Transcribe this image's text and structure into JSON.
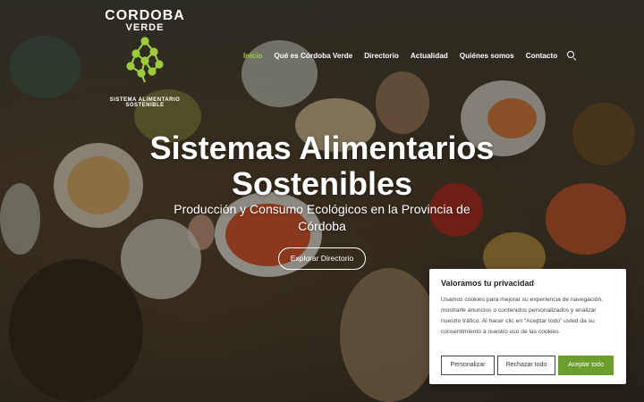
{
  "logo": {
    "title": "CORDOBA",
    "subtitle": "VERDE",
    "arc_text": "SISTEMA ALIMENTARIO SOSTENIBLE"
  },
  "nav": {
    "items": [
      {
        "label": "Inicio",
        "active": true
      },
      {
        "label": "Qué es Córdoba Verde"
      },
      {
        "label": "Directorio"
      },
      {
        "label": "Actualidad"
      },
      {
        "label": "Quiénes somos"
      },
      {
        "label": "Contacto"
      }
    ],
    "search_icon": "search-icon"
  },
  "hero": {
    "title": "Sistemas Alimentarios Sostenibles",
    "subtitle": "Producción y Consumo Ecológicos en la Provincia de Córdoba",
    "cta": "Explorar Directorio"
  },
  "cookie": {
    "title": "Valoramos tu privacidad",
    "text": "Usamos cookies para mejorar su experiencia de navegación, mostrarle anuncios o contenidos personalizados y analizar nuestro tráfico. Al hacer clic en “Aceptar todo” usted da su consentimiento a nuestro uso de las cookies.",
    "customize": "Personalizar",
    "reject": "Rechazar todo",
    "accept": "Aceptar todo"
  },
  "colors": {
    "accent": "#9ccc3c",
    "accept_button": "#6b9e2c"
  }
}
